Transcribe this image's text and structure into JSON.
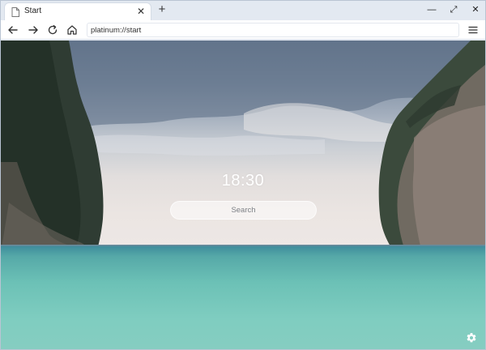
{
  "tab": {
    "title": "Start",
    "close_glyph": "✕",
    "icon": "page-icon"
  },
  "new_tab_glyph": "+",
  "window_controls": {
    "minimize": "—",
    "maximize": "⤢",
    "close": "✕"
  },
  "toolbar": {
    "back_icon": "arrow-left-icon",
    "forward_icon": "arrow-right-icon",
    "reload_icon": "reload-icon",
    "home_icon": "home-icon",
    "address_value": "platinum://start",
    "menu_icon": "hamburger-icon"
  },
  "start_page": {
    "clock": "18:30",
    "search_placeholder": "Search",
    "settings_icon": "gear-icon"
  },
  "colors": {
    "sea": "#6cc1b6",
    "sky": "#8494a7",
    "accent": "#ffffff"
  }
}
